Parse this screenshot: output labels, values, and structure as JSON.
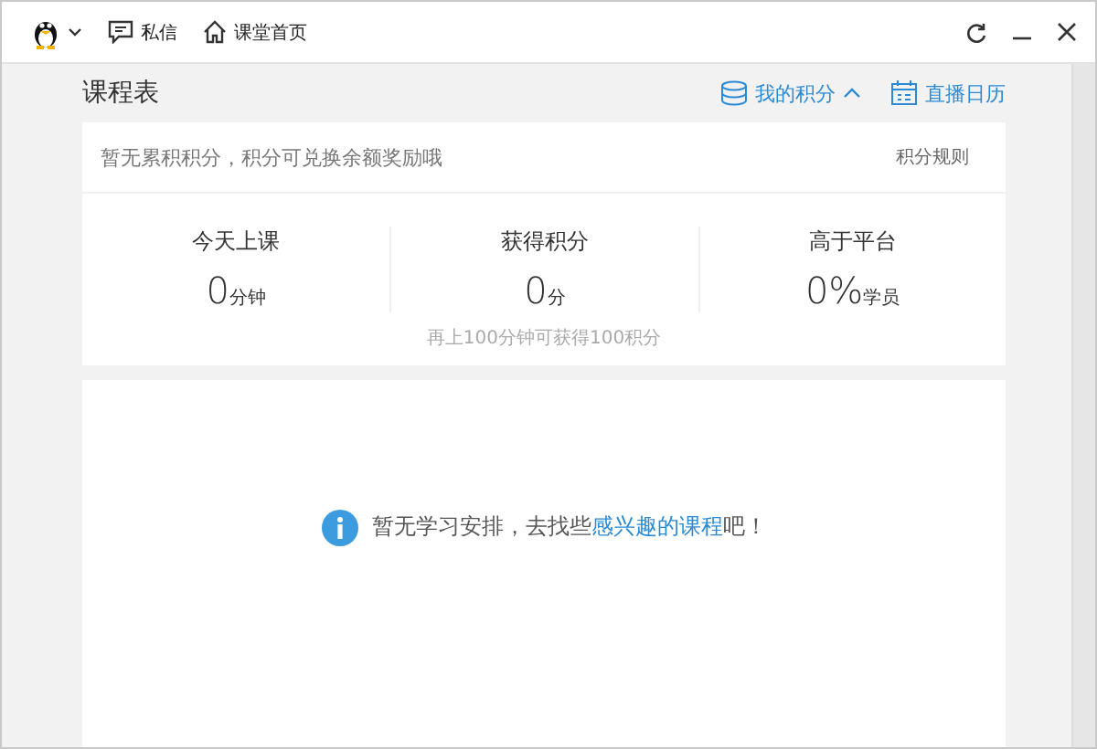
{
  "titlebar": {
    "nav": [
      {
        "kind": "message",
        "label": "私信"
      },
      {
        "kind": "home",
        "label": "课堂首页"
      }
    ]
  },
  "header": {
    "title": "课程表",
    "points_button": {
      "label": "我的积分",
      "expanded": true
    },
    "calendar_button": {
      "label": "直播日历"
    }
  },
  "points": {
    "notice": "暂无累积积分，积分可兑换余额奖励哦",
    "rules_link": "积分规则",
    "stats": [
      {
        "label": "今天上课",
        "value": "0",
        "unit": "分钟"
      },
      {
        "label": "获得积分",
        "value": "0",
        "unit": "分"
      },
      {
        "label": "高于平台",
        "value": "0%",
        "unit": "学员"
      }
    ],
    "hint": "再上100分钟可获得100积分"
  },
  "empty_state": {
    "text_before": "暂无学习安排，去找些",
    "link": "感兴趣的课程",
    "text_after": "吧！"
  }
}
